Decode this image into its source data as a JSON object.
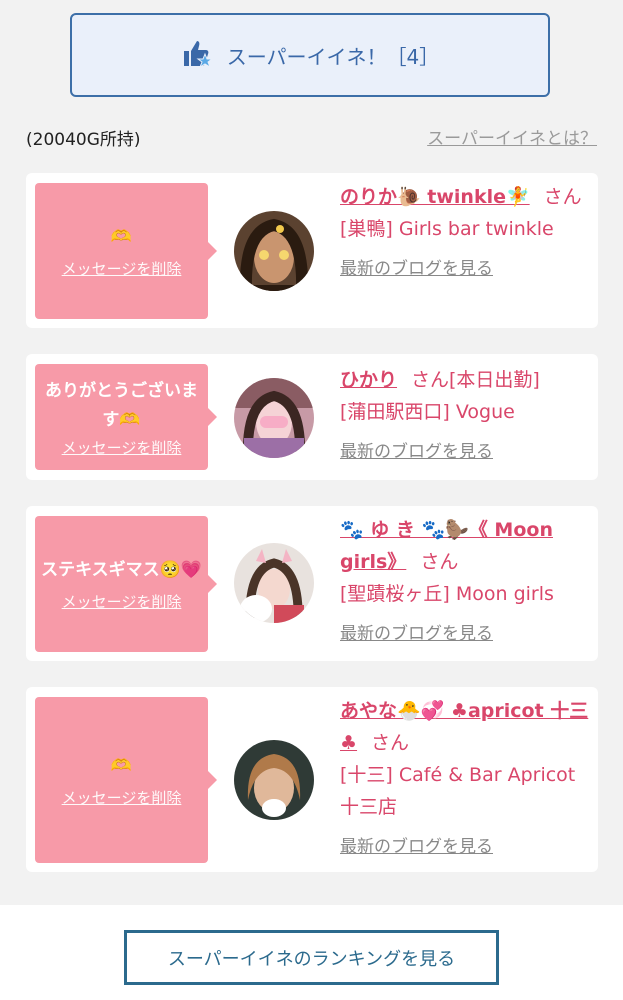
{
  "header": {
    "super_like_label": "スーパーイイネ！［4］",
    "gold_text": "(20040G所持)",
    "what_link": "スーパーイイネとは？"
  },
  "cards": [
    {
      "message": "🫶",
      "delete_label": "メッセージを削除",
      "name": "のりか🐌 twinkle🧚",
      "san": "さん",
      "shop": "[巣鴨] Girls bar twinkle",
      "blog_link": "最新のブログを見る"
    },
    {
      "message": "ありがとうございます🫶",
      "delete_label": "メッセージを削除",
      "name": "ひかり",
      "san": "さん[本日出勤]",
      "shop": "[蒲田駅西口] Vogue",
      "blog_link": "最新のブログを見る"
    },
    {
      "message": "ステキスギマス🥺💗",
      "delete_label": "メッセージを削除",
      "name": "🐾 ゆ き 🐾🦫《 Moon girls》",
      "san": "さん",
      "shop": "[聖蹟桜ヶ丘] Moon girls",
      "blog_link": "最新のブログを見る"
    },
    {
      "message": "🫶",
      "delete_label": "メッセージを削除",
      "name": "あやな🐣💞 ♣apricot 十三♣",
      "san": "さん",
      "shop": "[十三] Café & Bar Apricot 十三店",
      "blog_link": "最新のブログを見る"
    }
  ],
  "footer": {
    "ranking_button": "スーパーイイネのランキングを見る"
  },
  "colors": {
    "accent_blue": "#3a68a8",
    "pink_bubble": "#f79aa8",
    "pink_text": "#d9466a",
    "ranking_border": "#2b6a8d"
  },
  "icons": [
    "thumbs-up-star-icon"
  ]
}
